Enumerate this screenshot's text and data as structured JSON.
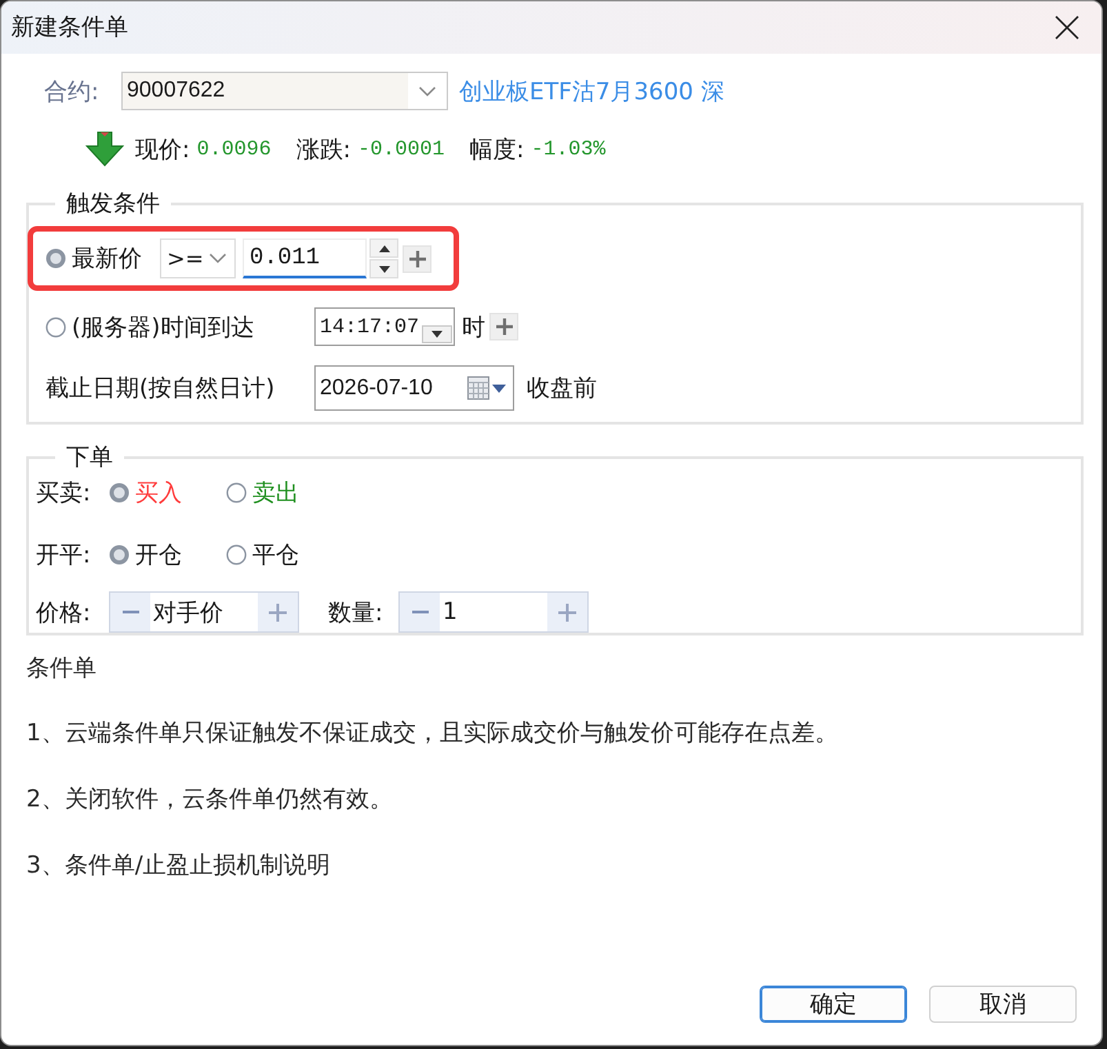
{
  "window": {
    "title": "新建条件单"
  },
  "contract": {
    "label": "合约:",
    "code": "90007622",
    "name": "创业板ETF沽7月3600 深"
  },
  "quote": {
    "falling": true,
    "items": [
      {
        "label": "现价:",
        "value": "0.0096"
      },
      {
        "label": "涨跌:",
        "value": "-0.0001"
      },
      {
        "label": "幅度:",
        "value": "-1.03%"
      }
    ]
  },
  "trigger": {
    "title": "触发条件",
    "price": {
      "selected": true,
      "highlighted": true,
      "label": "最新价",
      "operator": ">=",
      "value": "0.011"
    },
    "time": {
      "selected": false,
      "label": "(服务器)时间到达",
      "value": "14:17:07",
      "unit": "时"
    },
    "expiry": {
      "label": "截止日期(按自然日计)",
      "date": "2026-07-10",
      "suffix": "收盘前"
    }
  },
  "order": {
    "title": "下单",
    "choices": [
      {
        "label": "买卖:",
        "options": [
          {
            "label": "买入",
            "selected": true,
            "color": "#ff3b3b"
          },
          {
            "label": "卖出",
            "selected": false,
            "color": "#1f8f1f"
          }
        ]
      },
      {
        "label": "开平:",
        "options": [
          {
            "label": "开仓",
            "selected": true
          },
          {
            "label": "平仓",
            "selected": false
          }
        ]
      }
    ],
    "steppers": [
      {
        "label": "价格:",
        "value": "对手价"
      },
      {
        "label": "数量:",
        "value": "1"
      }
    ]
  },
  "notes": {
    "title": "条件单",
    "lines": [
      "1、云端条件单只保证触发不保证成交，且实际成交价与触发价可能存在点差。",
      "2、关闭软件，云条件单仍然有效。",
      "3、条件单/止盈止损机制说明"
    ]
  },
  "buttons": [
    {
      "label": "确定",
      "focused": true
    },
    {
      "label": "取消",
      "focused": false
    }
  ]
}
